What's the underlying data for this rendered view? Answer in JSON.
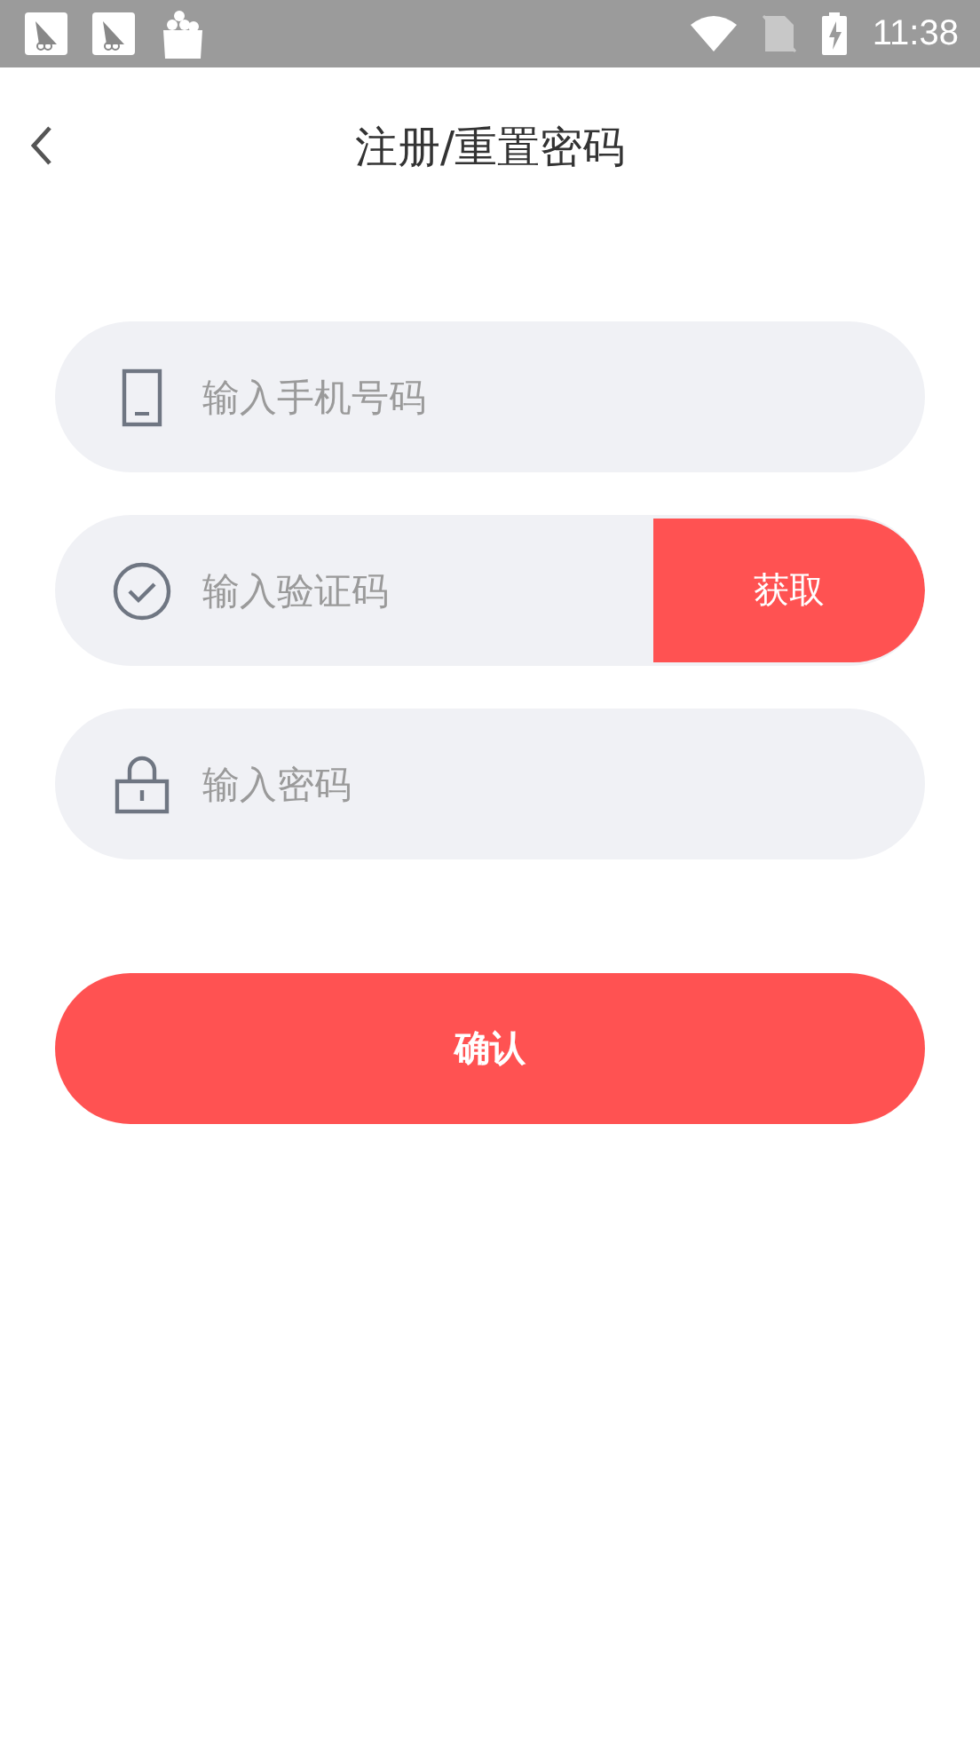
{
  "status_bar": {
    "time": "11:38"
  },
  "header": {
    "title": "注册/重置密码"
  },
  "fields": [
    {
      "kind": "phone",
      "placeholder": "输入手机号码"
    },
    {
      "kind": "code",
      "placeholder": "输入验证码",
      "button": "获取"
    },
    {
      "kind": "password",
      "placeholder": "输入密码"
    }
  ],
  "submit": "确认"
}
